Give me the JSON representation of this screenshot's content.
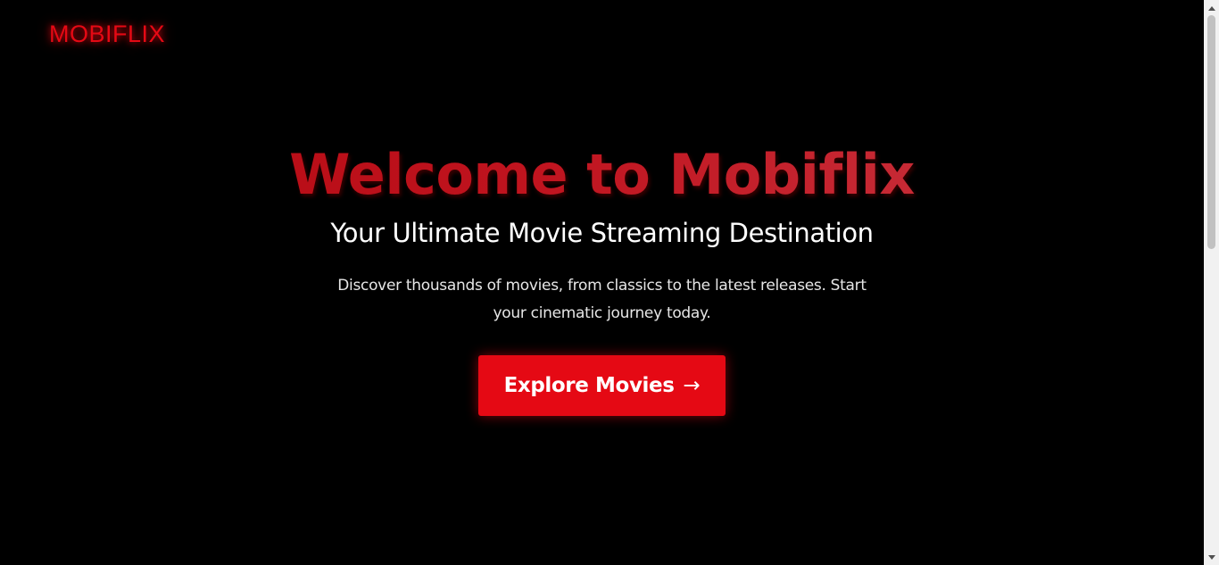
{
  "header": {
    "logo_text": "MOBIFLIX"
  },
  "hero": {
    "title": "Welcome to Mobiflix",
    "subtitle": "Your Ultimate Movie Streaming Destination",
    "description": "Discover thousands of movies, from classics to the latest releases. Start your cinematic journey today.",
    "cta_label": "Explore Movies",
    "cta_icon": "→"
  },
  "colors": {
    "background": "#000000",
    "brand_red": "#e50914",
    "text_primary": "#ffffff"
  },
  "icons": {
    "cta_icon_name": "arrow-right-icon",
    "scroll_up_icon_name": "chevron-up-icon",
    "scroll_down_icon_name": "chevron-down-icon"
  }
}
